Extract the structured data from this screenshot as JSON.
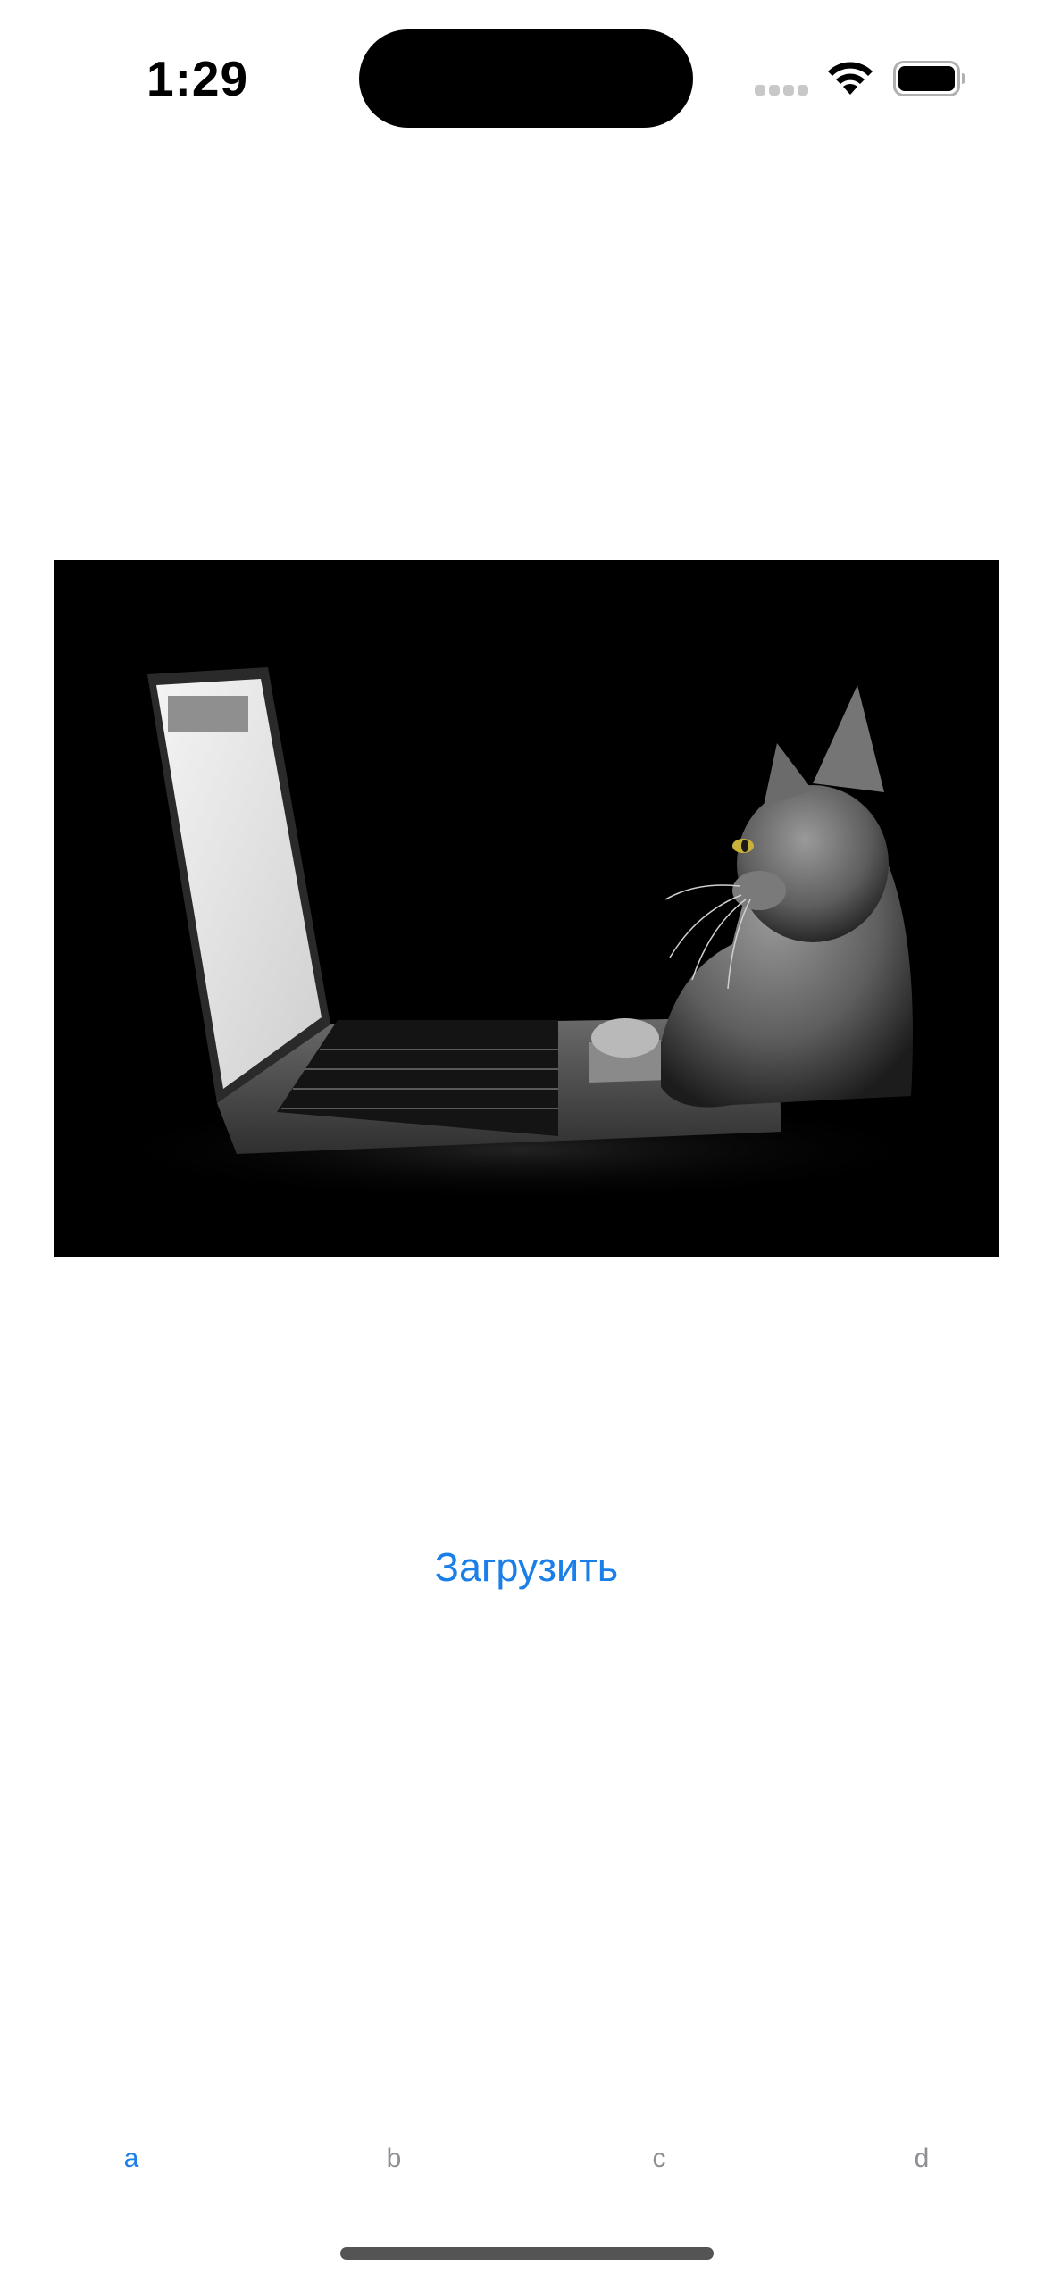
{
  "status_bar": {
    "time": "1:29",
    "icons": [
      "signal-icon",
      "wifi-icon",
      "battery-icon"
    ]
  },
  "main": {
    "image": {
      "description_icon": "photo-cat-laptop",
      "colors": {
        "background": "#000000"
      }
    },
    "load_button_label": "Загрузить"
  },
  "tab_bar": {
    "tabs": [
      {
        "label": "a",
        "active": true
      },
      {
        "label": "b",
        "active": false
      },
      {
        "label": "c",
        "active": false
      },
      {
        "label": "d",
        "active": false
      }
    ]
  },
  "colors": {
    "accent": "#1A7FE8",
    "inactive_tab": "#8E8E93",
    "background": "#FFFFFF"
  }
}
